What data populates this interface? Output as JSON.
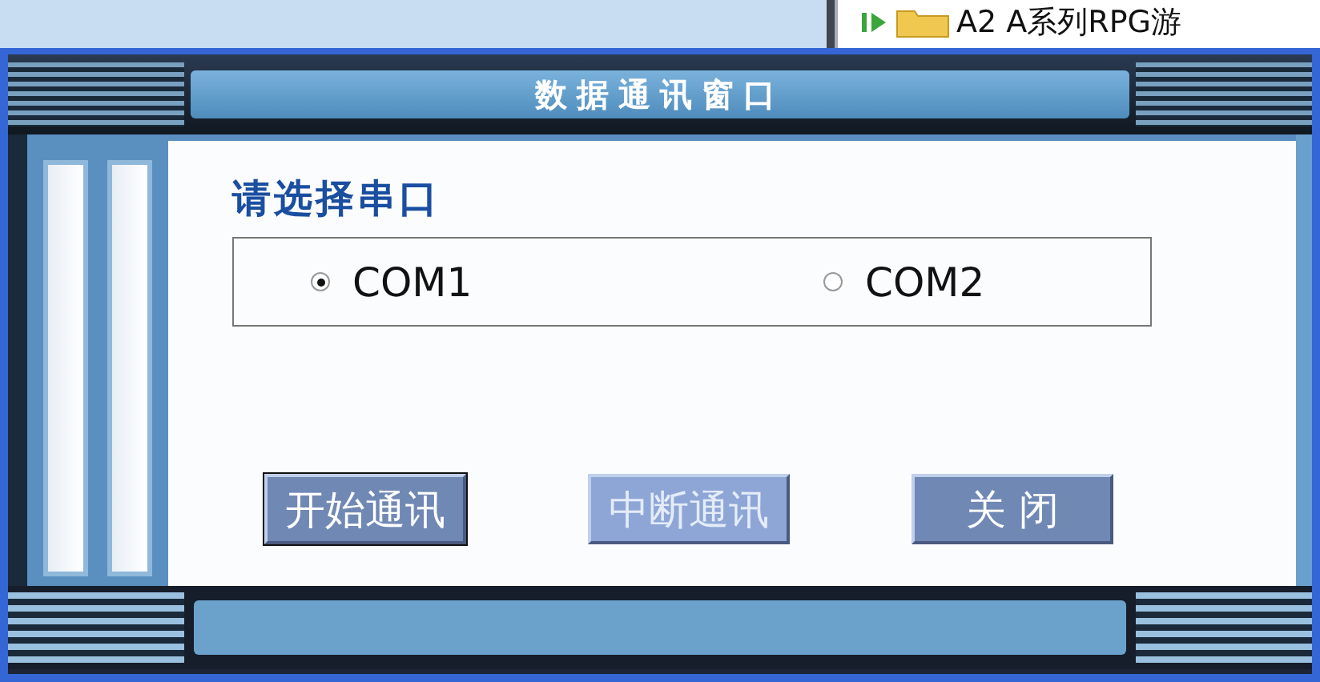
{
  "background_tree": {
    "item": {
      "label": "A2 A系列RPG游"
    }
  },
  "window": {
    "title": "数据通讯窗口"
  },
  "port_group": {
    "heading": "请选择串口",
    "options": [
      {
        "label": "COM1",
        "selected": true
      },
      {
        "label": "COM2",
        "selected": false
      }
    ]
  },
  "buttons": [
    {
      "label": "开始通讯",
      "disabled": false,
      "focused": true
    },
    {
      "label": "中断通讯",
      "disabled": true,
      "focused": false
    },
    {
      "label": "关 闭",
      "disabled": false,
      "focused": false
    }
  ]
}
